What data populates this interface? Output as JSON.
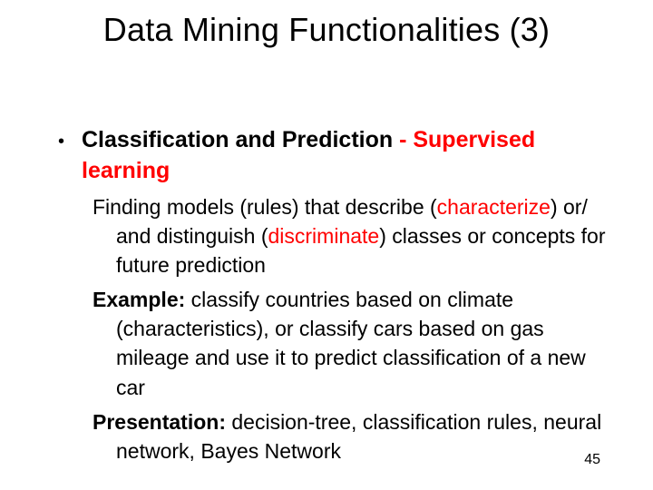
{
  "title": "Data Mining Functionalities (3)",
  "bullet": {
    "dot": "•",
    "headline": "Classification and Prediction",
    "sub_sep": "  - ",
    "sub1": "Supervised",
    "sub2": "learning"
  },
  "para1": {
    "a": "Finding models (rules) that describe (",
    "b": "characterize",
    "c": ") or/ and distinguish (",
    "d": "discriminate",
    "e": ") classes or concepts for future prediction"
  },
  "para2": {
    "lead": "Example:",
    "text": " classify countries based on climate (characteristics), or classify cars based on gas mileage and use it to predict classification of a new car"
  },
  "para3": {
    "lead": "Presentation:",
    "text": " decision-tree, classification rules, neural network, Bayes Network"
  },
  "page_number": "45"
}
